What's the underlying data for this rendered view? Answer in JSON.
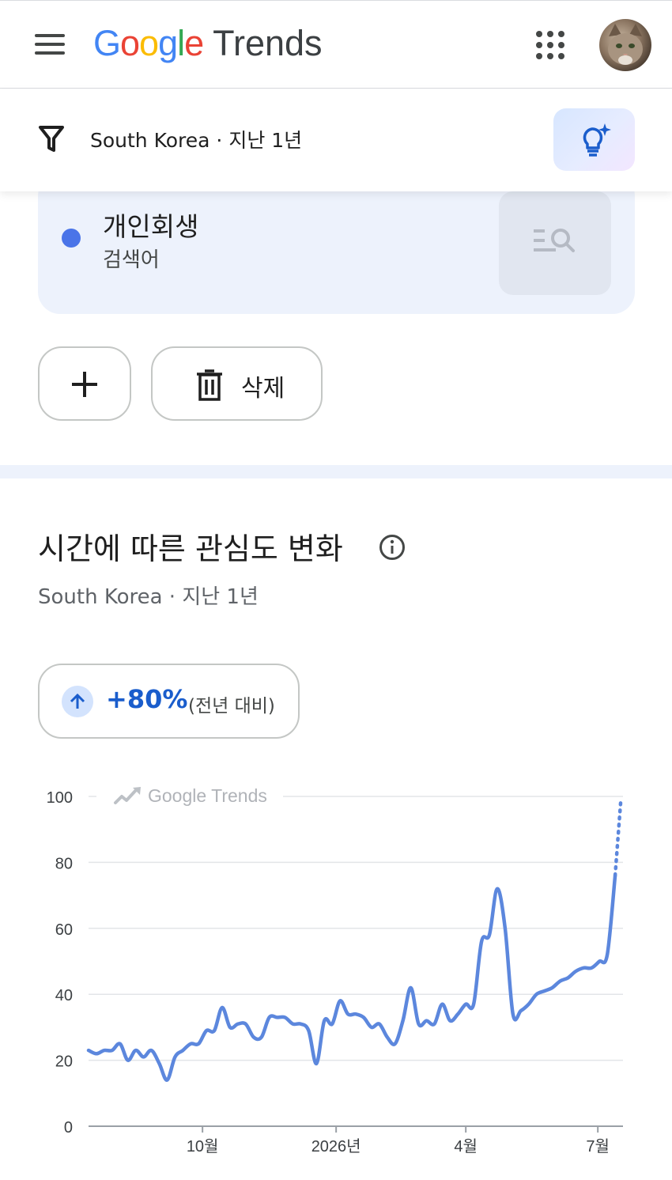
{
  "header": {
    "logo_google": [
      "G",
      "o",
      "o",
      "g",
      "l",
      "e"
    ],
    "logo_trends": "Trends"
  },
  "filter": {
    "text": "South Korea · 지난 1년"
  },
  "term": {
    "name": "개인회생",
    "type": "검색어",
    "dot_color": "#4a74e8"
  },
  "actions": {
    "delete_label": "삭제"
  },
  "section": {
    "title": "시간에 따른 관심도 변화",
    "subtitle": "South Korea · 지난 1년",
    "yoy_value": "+80%",
    "yoy_note": "(전년 대비)"
  },
  "chart_data": {
    "type": "line",
    "watermark": "Google Trends",
    "ylim": [
      0,
      100
    ],
    "yticks": [
      0,
      20,
      40,
      60,
      80,
      100
    ],
    "xtick_labels": [
      "10월",
      "2026년",
      "4월",
      "7월"
    ],
    "xtick_positions": [
      14.5,
      31.5,
      48,
      64.8
    ],
    "x_range": [
      0,
      68
    ],
    "line_color": "#5c87dd",
    "series": [
      {
        "x": [
          0,
          1,
          2,
          3,
          4,
          5,
          6,
          7,
          8,
          9,
          10,
          11,
          12,
          13,
          14,
          15,
          16,
          17,
          18,
          19,
          20,
          21,
          22,
          23,
          24,
          25,
          26,
          27,
          28,
          29,
          30,
          31,
          32,
          33,
          34,
          35,
          36,
          37,
          38,
          39,
          40,
          41,
          42,
          43,
          44,
          45,
          46,
          47,
          48,
          49,
          50,
          51,
          52,
          53,
          54,
          55,
          56,
          57,
          58,
          59,
          60,
          61,
          62,
          63,
          64,
          65,
          66,
          67
        ],
        "values": [
          23,
          22,
          23,
          23,
          25,
          20,
          23,
          21,
          23,
          19,
          14,
          21,
          23,
          25,
          25,
          29,
          29,
          36,
          30,
          31,
          31,
          27,
          27,
          33,
          33,
          33,
          31,
          31,
          29,
          19,
          32,
          31,
          38,
          34,
          34,
          33,
          30,
          31,
          27,
          25,
          32,
          42,
          31,
          32,
          31,
          37,
          32,
          34,
          37,
          37,
          56,
          58,
          72,
          60,
          34,
          35,
          37,
          40,
          41,
          42,
          44,
          45,
          47,
          48,
          48,
          50,
          52,
          76
        ],
        "partial_from_index": 67,
        "partial_value": 98
      }
    ]
  }
}
